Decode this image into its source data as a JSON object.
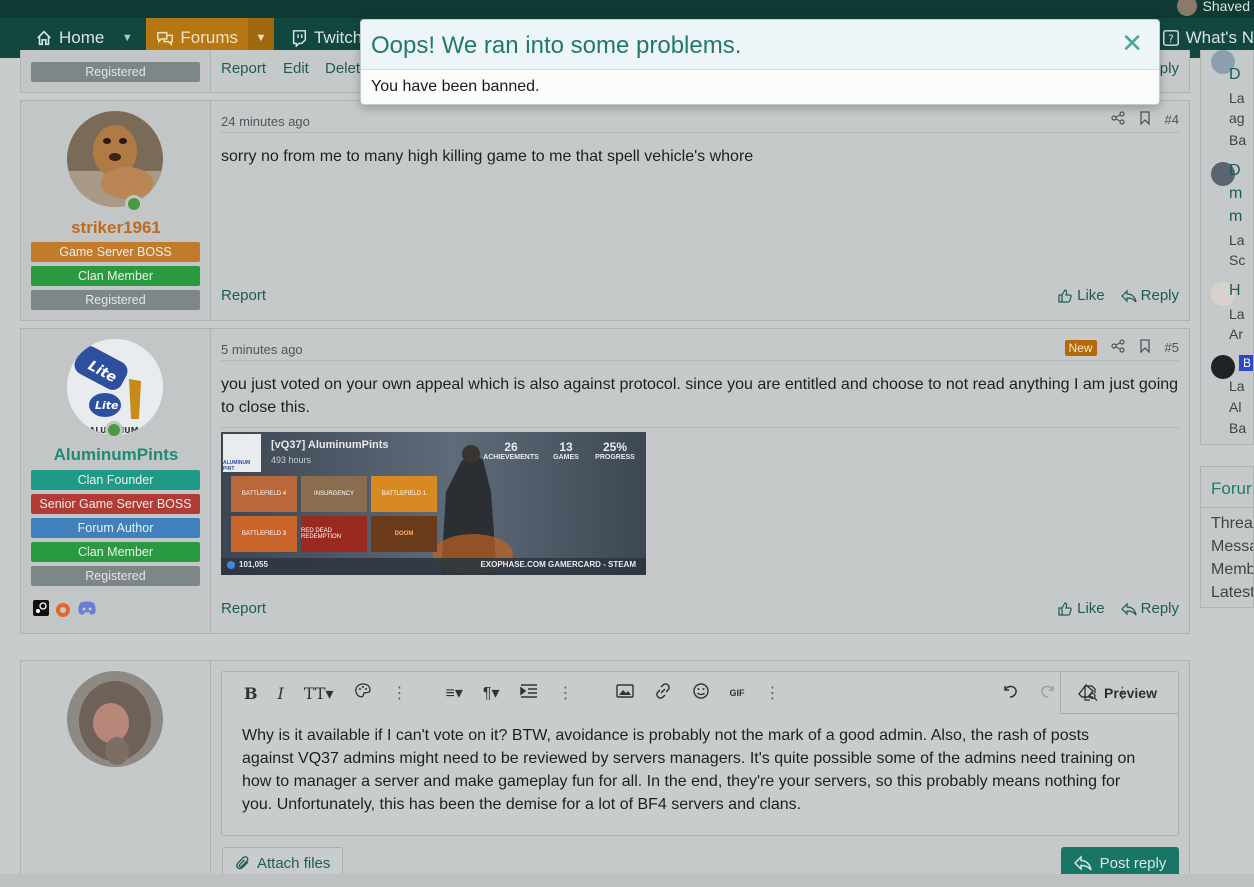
{
  "header": {
    "user_name": "Shaved",
    "nav": [
      {
        "label": "Home"
      },
      {
        "label": "Forums"
      },
      {
        "label": "Twitch"
      }
    ],
    "whats_new": "What's N"
  },
  "modal": {
    "title": "Oops! We ran into some problems.",
    "message": "You have been banned.",
    "close": "✕"
  },
  "prev_post": {
    "role": "Registered",
    "actions": {
      "report": "Report",
      "edit": "Edit",
      "delete": "Delet",
      "reply": "eply"
    }
  },
  "posts": [
    {
      "author": "striker1961",
      "author_color": "#c06a1e",
      "roles": [
        "Game Server BOSS",
        "Clan Member",
        "Registered"
      ],
      "time": "24 minutes ago",
      "number": "#4",
      "message": "sorry no from me to many high killing game to me that spell vehicle's whore",
      "report": "Report",
      "like": "Like",
      "reply": "Reply"
    },
    {
      "author": "AluminumPints",
      "author_color": "#1f8a76",
      "roles": [
        "Clan Founder",
        "Senior Game Server BOSS",
        "Forum Author",
        "Clan Member",
        "Registered"
      ],
      "time": "5 minutes ago",
      "new_badge": "New",
      "number": "#5",
      "message": "you just voted on your own appeal which is also against protocol. since you are entitled and choose to not read anything I am just going to close this.",
      "report": "Report",
      "like": "Like",
      "reply": "Reply",
      "gamercard": {
        "name": "[vQ37] AluminumPints",
        "hours": "493 hours",
        "achievements_value": "26",
        "achievements_label": "ACHIEVEMENTS",
        "games_value": "13",
        "games_label": "GAMES",
        "progress_value": "25%",
        "progress_label": "PROGRESS",
        "score": "101,055",
        "footer": "EXOPHASE.COM GAMERCARD - STEAM",
        "avatar_text": "ALUMINUM PINT",
        "games": [
          "BATTLEFIELD 4",
          "INSURGENCY",
          "BATTLEFIELD 1",
          "BATTLEFIELD 3",
          "RED DEAD REDEMPTION",
          "DOOM"
        ]
      }
    }
  ],
  "editor": {
    "toolbar": [
      "B",
      "I",
      "TT▾",
      "palette",
      "⋮",
      "≡▾",
      "¶▾",
      "indent",
      "⋮",
      "image",
      "link",
      "smile",
      "GIF",
      "⋮",
      "undo",
      "redo",
      "erase",
      "⋮"
    ],
    "preview": "Preview",
    "text": "Why is it available if I can't vote on it?  BTW, avoidance is probably not the mark of a good admin.  Also, the rash of posts against VQ37 admins might need to be reviewed by servers managers.  It's quite possible some of the admins need training on how to manager a server and make gameplay fun for all.  In the end, they're your servers, so this probably means nothing for you.  Unfortunately, this has been the demise for a lot of BF4 servers and clans.",
    "attach": "Attach files",
    "post_reply": "Post reply"
  },
  "sidebar": {
    "items": [
      {
        "line1": "D",
        "line2": "La",
        "line3": "ag",
        "line4": "Ba"
      },
      {
        "line1": "D",
        "line2": "m",
        "line3": "m",
        "line4": "La",
        "line5": "Sc"
      },
      {
        "line1": "H",
        "line2": "La",
        "line3": "Ar"
      },
      {
        "line1": "B",
        "line2": "La",
        "line3": "Al",
        "line4": "Ba"
      }
    ],
    "stats_title": "Forur",
    "stats": [
      "Threa",
      "Messa",
      "Memb",
      "Latest"
    ]
  }
}
